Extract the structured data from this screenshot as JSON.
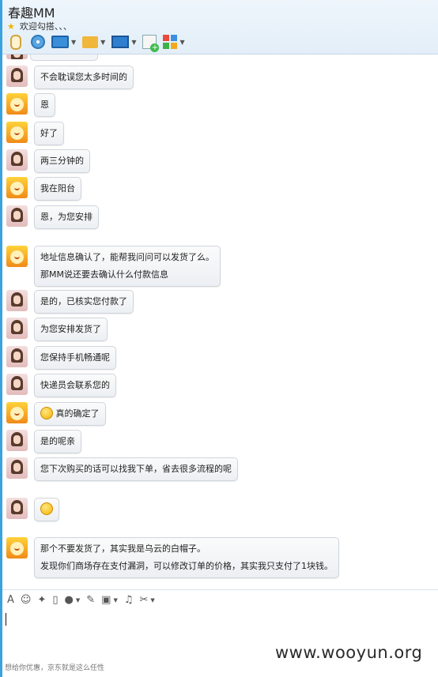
{
  "window": {
    "contact_name": "春趣MM",
    "status_text": "欢迎勾搭、、、"
  },
  "toolbar": {
    "items": [
      {
        "icon": "microphone-icon",
        "has_dropdown": false
      },
      {
        "icon": "webcam-icon",
        "has_dropdown": false
      },
      {
        "icon": "screen-share-icon",
        "has_dropdown": true
      },
      {
        "icon": "send-file-icon",
        "has_dropdown": true
      },
      {
        "icon": "remote-assist-icon",
        "has_dropdown": true
      },
      {
        "icon": "new-note-icon",
        "has_dropdown": false
      },
      {
        "icon": "apps-icon",
        "has_dropdown": true
      }
    ]
  },
  "messages": [
    {
      "from": "seller",
      "lines": [
        "不会耽误您太多时间的"
      ]
    },
    {
      "from": "buyer",
      "lines": [
        "恩"
      ]
    },
    {
      "from": "buyer",
      "lines": [
        "好了"
      ]
    },
    {
      "from": "seller",
      "lines": [
        "两三分钟的"
      ]
    },
    {
      "from": "buyer",
      "lines": [
        "我在阳台"
      ]
    },
    {
      "from": "seller",
      "lines": [
        "恩，为您安排"
      ]
    },
    {
      "from": "buyer",
      "lines": [
        "地址信息确认了，能帮我问问可以发货了么。",
        "那MM说还要去确认什么付款信息"
      ]
    },
    {
      "from": "seller",
      "lines": [
        "是的，已核实您付款了"
      ]
    },
    {
      "from": "seller",
      "lines": [
        "为您安排发货了"
      ]
    },
    {
      "from": "seller",
      "lines": [
        "您保持手机畅通呢"
      ]
    },
    {
      "from": "seller",
      "lines": [
        "快递员会联系您的"
      ]
    },
    {
      "from": "buyer",
      "lines": [
        "真的确定了"
      ],
      "emoji": "grin-emoji"
    },
    {
      "from": "seller",
      "lines": [
        "是的呢亲"
      ]
    },
    {
      "from": "seller",
      "lines": [
        "您下次购买的话可以找我下单，省去很多流程的呢"
      ]
    },
    {
      "from": "seller",
      "lines": [
        ""
      ],
      "emoji": "thinking-emoji"
    },
    {
      "from": "buyer",
      "lines": [
        "那个不要发货了，其实我是乌云的白帽子。",
        "发现你们商场存在支付漏洞，可以修改订单的价格，其实我只支付了1块钱。"
      ]
    }
  ],
  "input_toolbar": {
    "items": [
      {
        "icon": "font-icon",
        "glyph": "A",
        "has_dropdown": false
      },
      {
        "icon": "emoticon-icon",
        "glyph": "☺",
        "has_dropdown": false
      },
      {
        "icon": "magic-wand-icon",
        "glyph": "✦",
        "has_dropdown": false
      },
      {
        "icon": "screen-shake-icon",
        "glyph": "▯",
        "has_dropdown": false
      },
      {
        "icon": "voice-message-icon",
        "glyph": "●",
        "has_dropdown": true
      },
      {
        "icon": "edit-icon",
        "glyph": "✎",
        "has_dropdown": false
      },
      {
        "icon": "image-icon",
        "glyph": "▣",
        "has_dropdown": true
      },
      {
        "icon": "music-icon",
        "glyph": "♫",
        "has_dropdown": false
      },
      {
        "icon": "scissors-icon",
        "glyph": "✂",
        "has_dropdown": true
      }
    ]
  },
  "input": {
    "value": ""
  },
  "footer": {
    "hint_text": "想给你优惠，京东就是这么任性"
  },
  "watermark": "www.wooyun.org"
}
